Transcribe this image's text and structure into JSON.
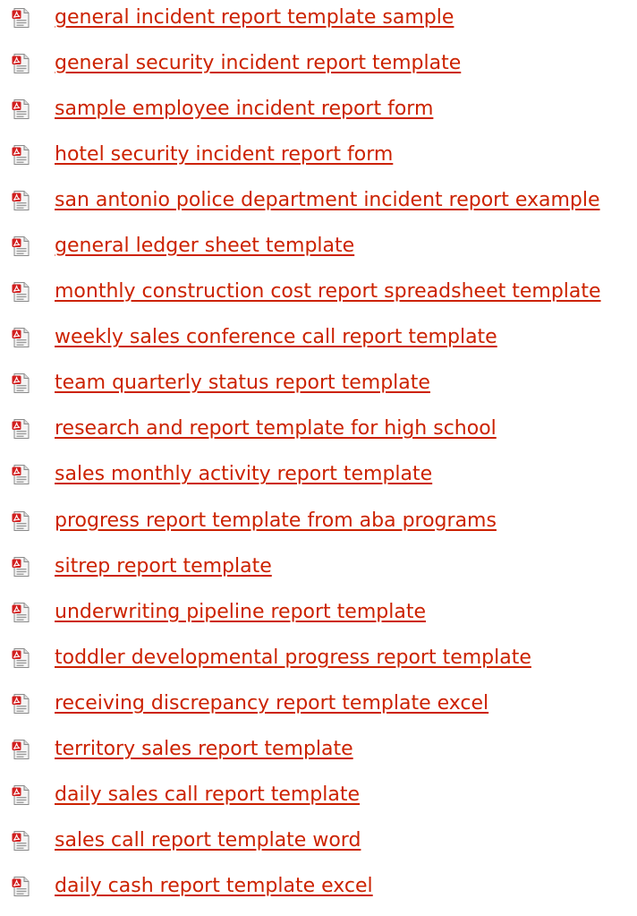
{
  "icon": "pdf-file-icon",
  "link_color": "#cc2200",
  "links": [
    {
      "label": "general incident report template sample"
    },
    {
      "label": "general security incident report template"
    },
    {
      "label": "sample employee incident report form"
    },
    {
      "label": "hotel security incident report form"
    },
    {
      "label": "san antonio police department incident report example"
    },
    {
      "label": "general ledger sheet template"
    },
    {
      "label": "monthly construction cost report spreadsheet template"
    },
    {
      "label": "weekly sales conference call report template"
    },
    {
      "label": "team quarterly status report template"
    },
    {
      "label": "research and report template for high school"
    },
    {
      "label": "sales monthly activity report template"
    },
    {
      "label": "progress report template from aba programs"
    },
    {
      "label": "sitrep report template"
    },
    {
      "label": "underwriting pipeline report template"
    },
    {
      "label": "toddler developmental progress report template"
    },
    {
      "label": "receiving discrepancy report template excel"
    },
    {
      "label": "territory sales report template"
    },
    {
      "label": "daily sales call report template"
    },
    {
      "label": "sales call report template word"
    },
    {
      "label": "daily cash report template excel"
    }
  ]
}
